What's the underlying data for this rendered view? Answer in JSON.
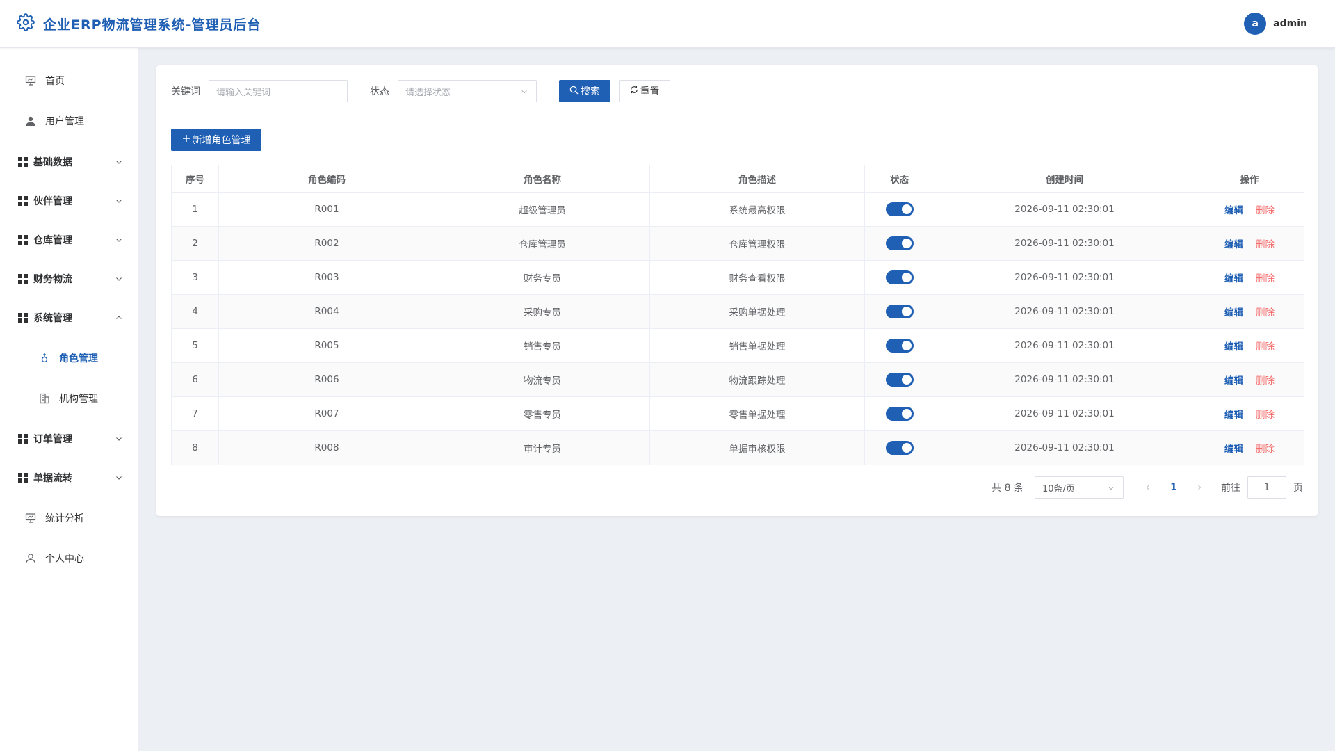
{
  "header": {
    "title": "企业ERP物流管理系统-管理员后台",
    "user_initial": "a",
    "username": "admin"
  },
  "sidebar": {
    "items": [
      {
        "label": "首页",
        "icon": "presentation-icon",
        "type": "leaf"
      },
      {
        "label": "用户管理",
        "icon": "user-icon",
        "type": "leaf"
      },
      {
        "label": "基础数据",
        "icon": "grid-icon",
        "type": "group",
        "expanded": false
      },
      {
        "label": "伙伴管理",
        "icon": "grid-icon",
        "type": "group",
        "expanded": false
      },
      {
        "label": "仓库管理",
        "icon": "grid-icon",
        "type": "group",
        "expanded": false
      },
      {
        "label": "财务物流",
        "icon": "grid-icon",
        "type": "group",
        "expanded": false
      },
      {
        "label": "系统管理",
        "icon": "grid-icon",
        "type": "group",
        "expanded": true
      },
      {
        "label": "角色管理",
        "icon": "female-icon",
        "type": "sub",
        "active": true
      },
      {
        "label": "机构管理",
        "icon": "building-icon",
        "type": "sub"
      },
      {
        "label": "订单管理",
        "icon": "grid-icon",
        "type": "group",
        "expanded": false
      },
      {
        "label": "单据流转",
        "icon": "grid-icon",
        "type": "group",
        "expanded": false
      },
      {
        "label": "统计分析",
        "icon": "presentation-icon",
        "type": "leaf"
      },
      {
        "label": "个人中心",
        "icon": "user-outline-icon",
        "type": "leaf"
      }
    ]
  },
  "filters": {
    "keyword_label": "关键词",
    "keyword_placeholder": "请输入关键词",
    "status_label": "状态",
    "status_placeholder": "请选择状态",
    "search_label": "搜索",
    "reset_label": "重置"
  },
  "add_button_label": "新增角色管理",
  "table": {
    "columns": [
      "序号",
      "角色编码",
      "角色名称",
      "角色描述",
      "状态",
      "创建时间",
      "操作"
    ],
    "rows": [
      {
        "index": "1",
        "code": "R001",
        "name": "超级管理员",
        "desc": "系统最高权限",
        "status": true,
        "created": "2026-09-11 02:30:01"
      },
      {
        "index": "2",
        "code": "R002",
        "name": "仓库管理员",
        "desc": "仓库管理权限",
        "status": true,
        "created": "2026-09-11 02:30:01"
      },
      {
        "index": "3",
        "code": "R003",
        "name": "财务专员",
        "desc": "财务查看权限",
        "status": true,
        "created": "2026-09-11 02:30:01"
      },
      {
        "index": "4",
        "code": "R004",
        "name": "采购专员",
        "desc": "采购单据处理",
        "status": true,
        "created": "2026-09-11 02:30:01"
      },
      {
        "index": "5",
        "code": "R005",
        "name": "销售专员",
        "desc": "销售单据处理",
        "status": true,
        "created": "2026-09-11 02:30:01"
      },
      {
        "index": "6",
        "code": "R006",
        "name": "物流专员",
        "desc": "物流跟踪处理",
        "status": true,
        "created": "2026-09-11 02:30:01"
      },
      {
        "index": "7",
        "code": "R007",
        "name": "零售专员",
        "desc": "零售单据处理",
        "status": true,
        "created": "2026-09-11 02:30:01"
      },
      {
        "index": "8",
        "code": "R008",
        "name": "审计专员",
        "desc": "单据审核权限",
        "status": true,
        "created": "2026-09-11 02:30:01"
      }
    ],
    "edit_label": "编辑",
    "delete_label": "删除"
  },
  "pagination": {
    "total_text": "共 8 条",
    "page_size": "10条/页",
    "current_page": "1",
    "goto_label": "前往",
    "goto_value": "1",
    "page_suffix": "页"
  },
  "colors": {
    "primary": "#1f5fb4",
    "danger": "#f56c6c",
    "background": "#eceff3"
  }
}
